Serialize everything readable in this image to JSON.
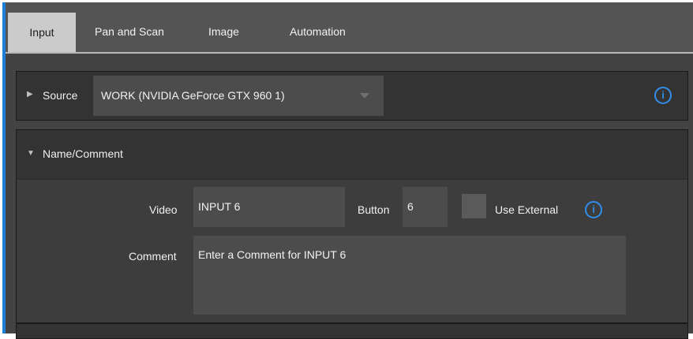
{
  "tabs": [
    {
      "label": "Input",
      "active": true
    },
    {
      "label": "Pan and Scan",
      "active": false
    },
    {
      "label": "Image",
      "active": false
    },
    {
      "label": "Automation",
      "active": false
    }
  ],
  "source": {
    "label": "Source",
    "value": "WORK (NVIDIA GeForce GTX 960 1)",
    "info_glyph": "i"
  },
  "name_comment": {
    "title": "Name/Comment",
    "video_label": "Video",
    "video_value": "INPUT 6",
    "button_label": "Button",
    "button_value": "6",
    "use_external_label": "Use External",
    "use_external_checked": false,
    "info_glyph": "i",
    "comment_label": "Comment",
    "comment_placeholder": "Enter a Comment for INPUT 6"
  },
  "icons": {
    "expander_collapsed": "▶",
    "expander_expanded": "▼"
  },
  "colors": {
    "accent": "#2f8ee8",
    "active_tab": "#cbcbcb",
    "panel": "#333333"
  }
}
